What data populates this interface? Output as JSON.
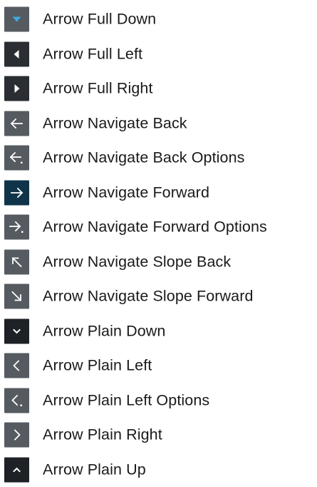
{
  "items": [
    {
      "label": "Arrow Full Down"
    },
    {
      "label": "Arrow Full Left"
    },
    {
      "label": "Arrow Full Right"
    },
    {
      "label": "Arrow Navigate Back"
    },
    {
      "label": "Arrow Navigate Back Options"
    },
    {
      "label": "Arrow Navigate Forward"
    },
    {
      "label": "Arrow Navigate Forward Options"
    },
    {
      "label": "Arrow Navigate Slope Back"
    },
    {
      "label": "Arrow Navigate Slope Forward"
    },
    {
      "label": "Arrow Plain Down"
    },
    {
      "label": "Arrow Plain Left"
    },
    {
      "label": "Arrow Plain Left Options"
    },
    {
      "label": "Arrow Plain Right"
    },
    {
      "label": "Arrow Plain Up"
    }
  ]
}
